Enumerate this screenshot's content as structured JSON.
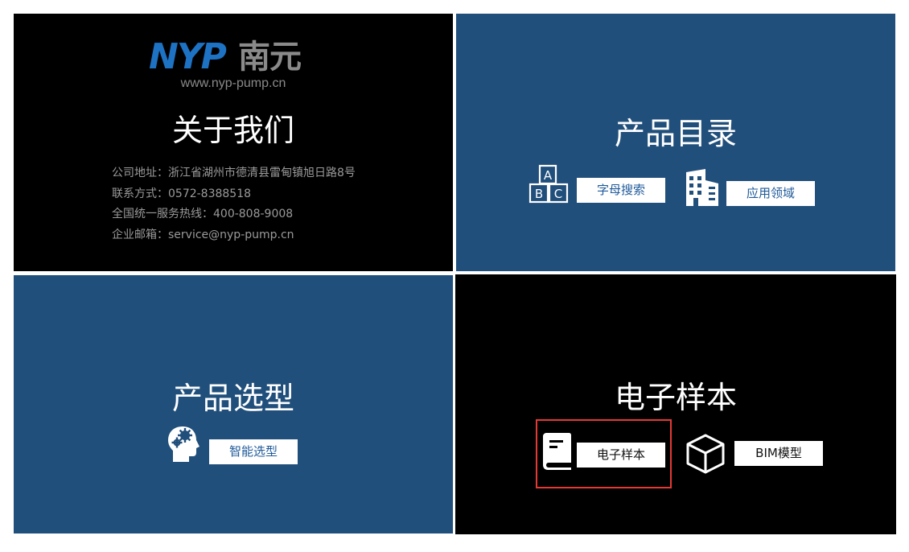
{
  "about": {
    "logo_latin": "NYP",
    "logo_chinese": "南元",
    "url": "www.nyp-pump.cn",
    "title": "关于我们",
    "info_lines": [
      "公司地址：浙江省湖州市德清县雷甸镇旭日路8号",
      "联系方式：0572-8388518",
      "全国统一服务热线：400-808-9008",
      "企业邮箱：service@nyp-pump.cn"
    ]
  },
  "catalog": {
    "title": "产品目录",
    "alpha_button": "字母搜索",
    "alpha_icon": "abc-blocks-icon",
    "field_button": "应用领域",
    "field_icon": "building-icon"
  },
  "selection": {
    "title": "产品选型",
    "smart_button": "智能选型",
    "smart_icon": "head-gears-icon"
  },
  "sample": {
    "title": "电子样本",
    "ebook_button": "电子样本",
    "ebook_icon": "book-icon",
    "bim_button": "BIM模型",
    "bim_icon": "cube-icon"
  },
  "colors": {
    "blue_panel": "#214f7b",
    "black_panel": "#000000",
    "logo_blue": "#1e72c4",
    "logo_gray": "#8a8a8a",
    "highlight_border": "#e53935"
  }
}
